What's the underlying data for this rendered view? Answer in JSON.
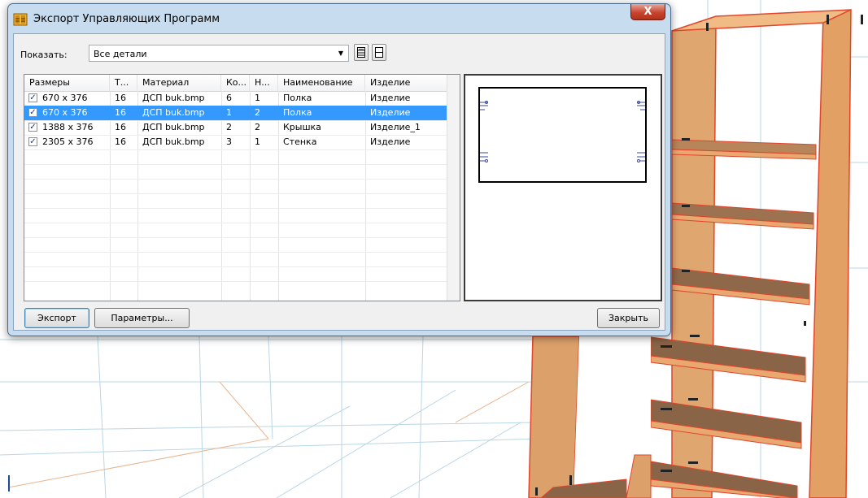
{
  "window": {
    "title": "Экспорт Управляющих Программ",
    "close_label": "X"
  },
  "filter": {
    "label": "Показать:",
    "value": "Все детали"
  },
  "table": {
    "headers": [
      "Размеры",
      "Т...",
      "Материал",
      "Ко...",
      "Н...",
      "Наименование",
      "Изделие"
    ],
    "rows": [
      {
        "checked": true,
        "size": "670 x 376",
        "t": "16",
        "material": "ДСП buk.bmp",
        "qty": "6",
        "n": "1",
        "name": "Полка",
        "product": "Изделие",
        "selected": false
      },
      {
        "checked": true,
        "size": "670 x 376",
        "t": "16",
        "material": "ДСП buk.bmp",
        "qty": "1",
        "n": "2",
        "name": "Полка",
        "product": "Изделие",
        "selected": true
      },
      {
        "checked": true,
        "size": "1388 x 376",
        "t": "16",
        "material": "ДСП buk.bmp",
        "qty": "2",
        "n": "2",
        "name": "Крышка",
        "product": "Изделие_1",
        "selected": false
      },
      {
        "checked": true,
        "size": "2305 x 376",
        "t": "16",
        "material": "ДСП buk.bmp",
        "qty": "3",
        "n": "1",
        "name": "Стенка",
        "product": "Изделие",
        "selected": false
      }
    ]
  },
  "buttons": {
    "export": "Экспорт",
    "params": "Параметры...",
    "close": "Закрыть"
  },
  "icons": {
    "title_icon": "cabinet-icon",
    "tool_button_1": "shelves-icon",
    "tool_button_2": "panel-icon"
  },
  "colors": {
    "selection": "#3399ff",
    "wood": "#e0a26a",
    "panel_edge": "#e8462a"
  }
}
